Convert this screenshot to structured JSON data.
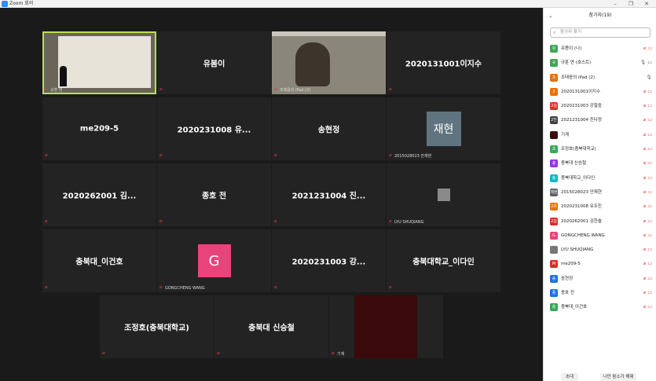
{
  "window": {
    "title": "Zoom 회의"
  },
  "stage": {
    "tiles": [
      {
        "label": "규훈 연",
        "type": "video-presenter"
      },
      {
        "name": "유봄이"
      },
      {
        "label": "조태응의 iPad (2)",
        "type": "video-person"
      },
      {
        "name": "2020131001이지수"
      },
      {
        "name": "me209-5"
      },
      {
        "name": "2020231008 유..."
      },
      {
        "name": "송현정"
      },
      {
        "label": "2015028023 안재현",
        "avatar_text": "재현"
      },
      {
        "name": "2020262001 김..."
      },
      {
        "name": "종호 전"
      },
      {
        "name": "2021231004 진..."
      },
      {
        "label": "LYU SHUQIANG",
        "type": "small-avatar"
      },
      {
        "name": "충북대_이건호"
      },
      {
        "label": "GONGCHENG WANG",
        "avatar_text": "G"
      },
      {
        "name": "2020231003 강..."
      },
      {
        "name": "충북대학교_이다인"
      },
      {
        "name": "조정호(충북대학교)"
      },
      {
        "name": "충북대 신승철"
      },
      {
        "label": "기계",
        "type": "dark-red"
      }
    ]
  },
  "panel": {
    "title": "참가자(19)",
    "search_placeholder": "참가자 찾기",
    "participants": [
      {
        "avatar": "유",
        "color": "#3aa757",
        "name": "유봄이 (나)"
      },
      {
        "avatar": "규",
        "color": "#3aa757",
        "name": "규훈 연 (호스트)"
      },
      {
        "avatar": "조",
        "color": "#e8710a",
        "name": "조태응의 iPad (2)"
      },
      {
        "avatar": "2",
        "color": "#e8710a",
        "name": "2020131001이지수"
      },
      {
        "avatar": "2김",
        "color": "#d93025",
        "name": "2020231003 강철중"
      },
      {
        "avatar": "2진",
        "color": "#3c4043",
        "name": "2021231004 진다정"
      },
      {
        "avatar": "",
        "color": "#3a0d0d",
        "name": "기계"
      },
      {
        "avatar": "조",
        "color": "#3aa757",
        "name": "조정호(충북대학교)"
      },
      {
        "avatar": "충",
        "color": "#9334e6",
        "name": "충북대 신승철"
      },
      {
        "avatar": "충",
        "color": "#12b5cb",
        "name": "충북대학교_이다인"
      },
      {
        "avatar": "재현",
        "color": "#5f6368",
        "name": "2015028023 안재현"
      },
      {
        "avatar": "2유",
        "color": "#e8710a",
        "name": "2020231008 유조진"
      },
      {
        "avatar": "2김",
        "color": "#d93025",
        "name": "2020262001 김한솔"
      },
      {
        "avatar": "G",
        "color": "#e8447a",
        "name": "GONGCHENG WANG"
      },
      {
        "avatar": "",
        "color": "#777777",
        "name": "LYU SHUQIANG"
      },
      {
        "avatar": "M",
        "color": "#d93025",
        "name": "me209-5"
      },
      {
        "avatar": "송",
        "color": "#1a73e8",
        "name": "송현정"
      },
      {
        "avatar": "종",
        "color": "#1a73e8",
        "name": "종호 전"
      },
      {
        "avatar": "충",
        "color": "#3aa757",
        "name": "충북대_이건호"
      }
    ],
    "footer": {
      "invite": "초대",
      "unmute_me": "나만 음소거 해제"
    }
  }
}
